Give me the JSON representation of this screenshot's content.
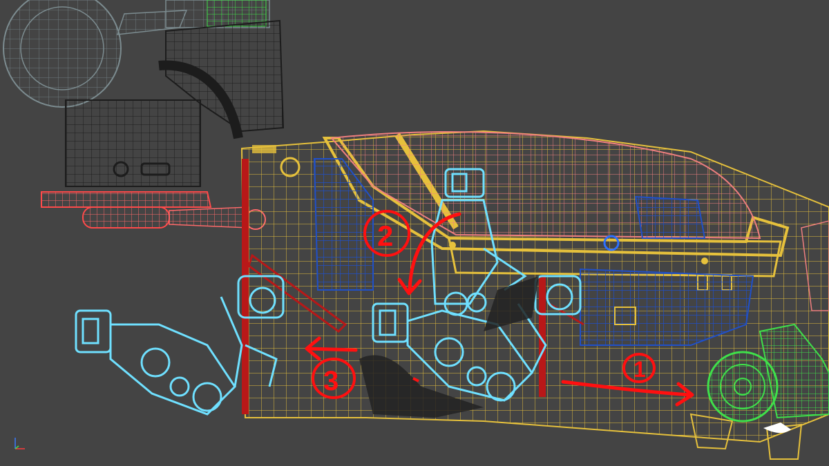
{
  "viewport": {
    "background": "#444444"
  },
  "colors": {
    "wire_dark": "#1c1c1c",
    "wire_gray": "#7c8c90",
    "wire_yellow": "#e6c13c",
    "wire_red": "#ff4a4a",
    "wire_pink": "#f07f7f",
    "wire_blue": "#2050c8",
    "wire_cyan": "#6fe0ff",
    "wire_green": "#3fe04a",
    "wire_darkred": "#b81818",
    "annotation": "#ff1010"
  },
  "annotations": {
    "step_1": "1",
    "step_2": "2",
    "step_3": "3"
  },
  "axis_gizmo": {
    "icon": "axis-gizmo-icon"
  }
}
